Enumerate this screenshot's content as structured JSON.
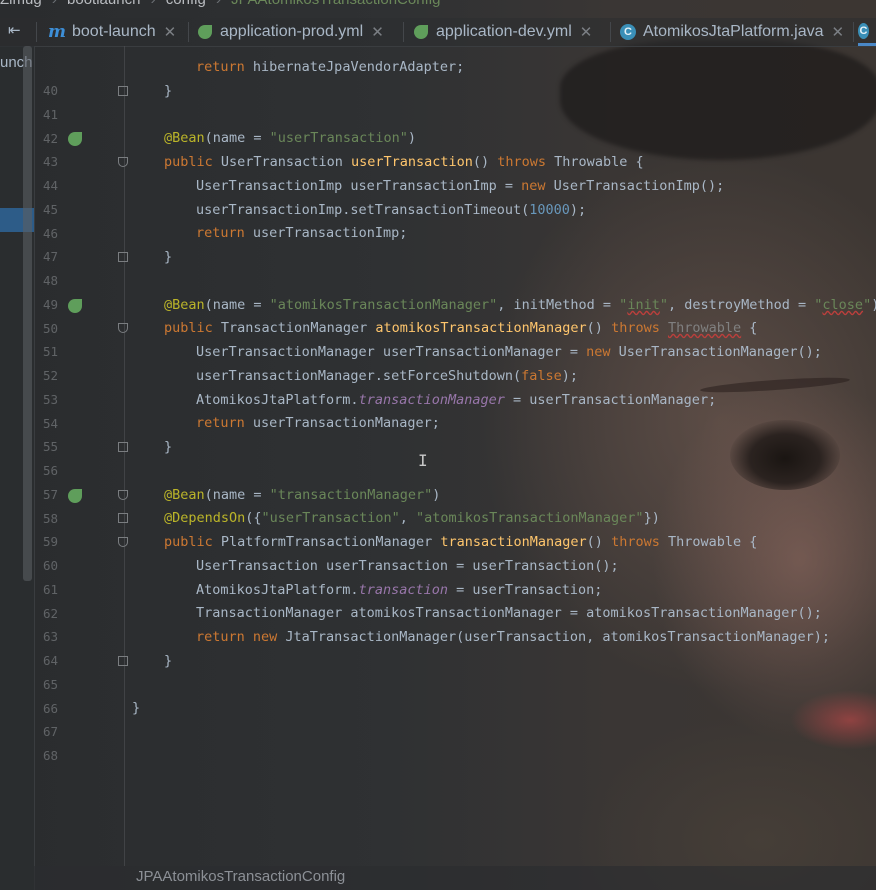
{
  "breadcrumbs": [
    "Zimug",
    "bootlaunch",
    "config",
    "JPAAtomikosTransactionConfig"
  ],
  "tabs": [
    {
      "label": "boot-launch",
      "icon": "module-icon",
      "closable": true,
      "active": false
    },
    {
      "label": "application-prod.yml",
      "icon": "spring-leaf-icon",
      "closable": true,
      "active": false
    },
    {
      "label": "application-dev.yml",
      "icon": "spring-leaf-icon",
      "closable": true,
      "active": false
    },
    {
      "label": "AtomikosJtaPlatform.java",
      "icon": "class-icon",
      "closable": true,
      "active": false
    }
  ],
  "project_panel": {
    "label": "unch",
    "collapse_icon": "⇤"
  },
  "editor": {
    "lines": [
      {
        "n": "40",
        "t": "return hibernateJpaVendorAdapter;"
      },
      {
        "n": "41",
        "t": "}"
      },
      {
        "n": "42",
        "t": ""
      },
      {
        "n": "43",
        "t": "@Bean(name = \"userTransaction\")"
      },
      {
        "n": "44",
        "t": "public UserTransaction userTransaction() throws Throwable {"
      },
      {
        "n": "45",
        "t": "UserTransactionImp userTransactionImp = new UserTransactionImp();"
      },
      {
        "n": "46",
        "t": "userTransactionImp.setTransactionTimeout(10000);"
      },
      {
        "n": "47",
        "t": "return userTransactionImp;"
      },
      {
        "n": "48",
        "t": "}"
      },
      {
        "n": "49",
        "t": ""
      },
      {
        "n": "50",
        "t": "@Bean(name = \"atomikosTransactionManager\", initMethod = \"init\", destroyMethod = \"close\")"
      },
      {
        "n": "51",
        "t": "public TransactionManager atomikosTransactionManager() throws Throwable {"
      },
      {
        "n": "52",
        "t": "UserTransactionManager userTransactionManager = new UserTransactionManager();"
      },
      {
        "n": "53",
        "t": "userTransactionManager.setForceShutdown(false);"
      },
      {
        "n": "54",
        "t": "AtomikosJtaPlatform.transactionManager = userTransactionManager;"
      },
      {
        "n": "55",
        "t": "return userTransactionManager;"
      },
      {
        "n": "56",
        "t": "}"
      },
      {
        "n": "57",
        "t": ""
      },
      {
        "n": "58",
        "t": "@Bean(name = \"transactionManager\")"
      },
      {
        "n": "59",
        "t": "@DependsOn({\"userTransaction\", \"atomikosTransactionManager\"})"
      },
      {
        "n": "60",
        "t": "public PlatformTransactionManager transactionManager() throws Throwable {"
      },
      {
        "n": "61",
        "t": "UserTransaction userTransaction = userTransaction();"
      },
      {
        "n": "62",
        "t": "AtomikosJtaPlatform.transaction = userTransaction;"
      },
      {
        "n": "63",
        "t": "TransactionManager atomikosTransactionManager = atomikosTransactionManager();"
      },
      {
        "n": "64",
        "t": "return new JtaTransactionManager(userTransaction, atomikosTransactionManager);"
      },
      {
        "n": "65",
        "t": "}"
      },
      {
        "n": "66",
        "t": ""
      },
      {
        "n": "67",
        "t": "}"
      },
      {
        "n": "68",
        "t": ""
      }
    ]
  },
  "status": {
    "breadcrumb": "JPAAtomikosTransactionConfig"
  },
  "colors": {
    "keyword": "#cc7832",
    "annotation": "#bbb529",
    "string": "#6a8759",
    "method": "#ffc66d",
    "number": "#6897bb",
    "field": "#9876aa",
    "text": "#a9b7c6",
    "active_tab": "#4a88c7"
  }
}
